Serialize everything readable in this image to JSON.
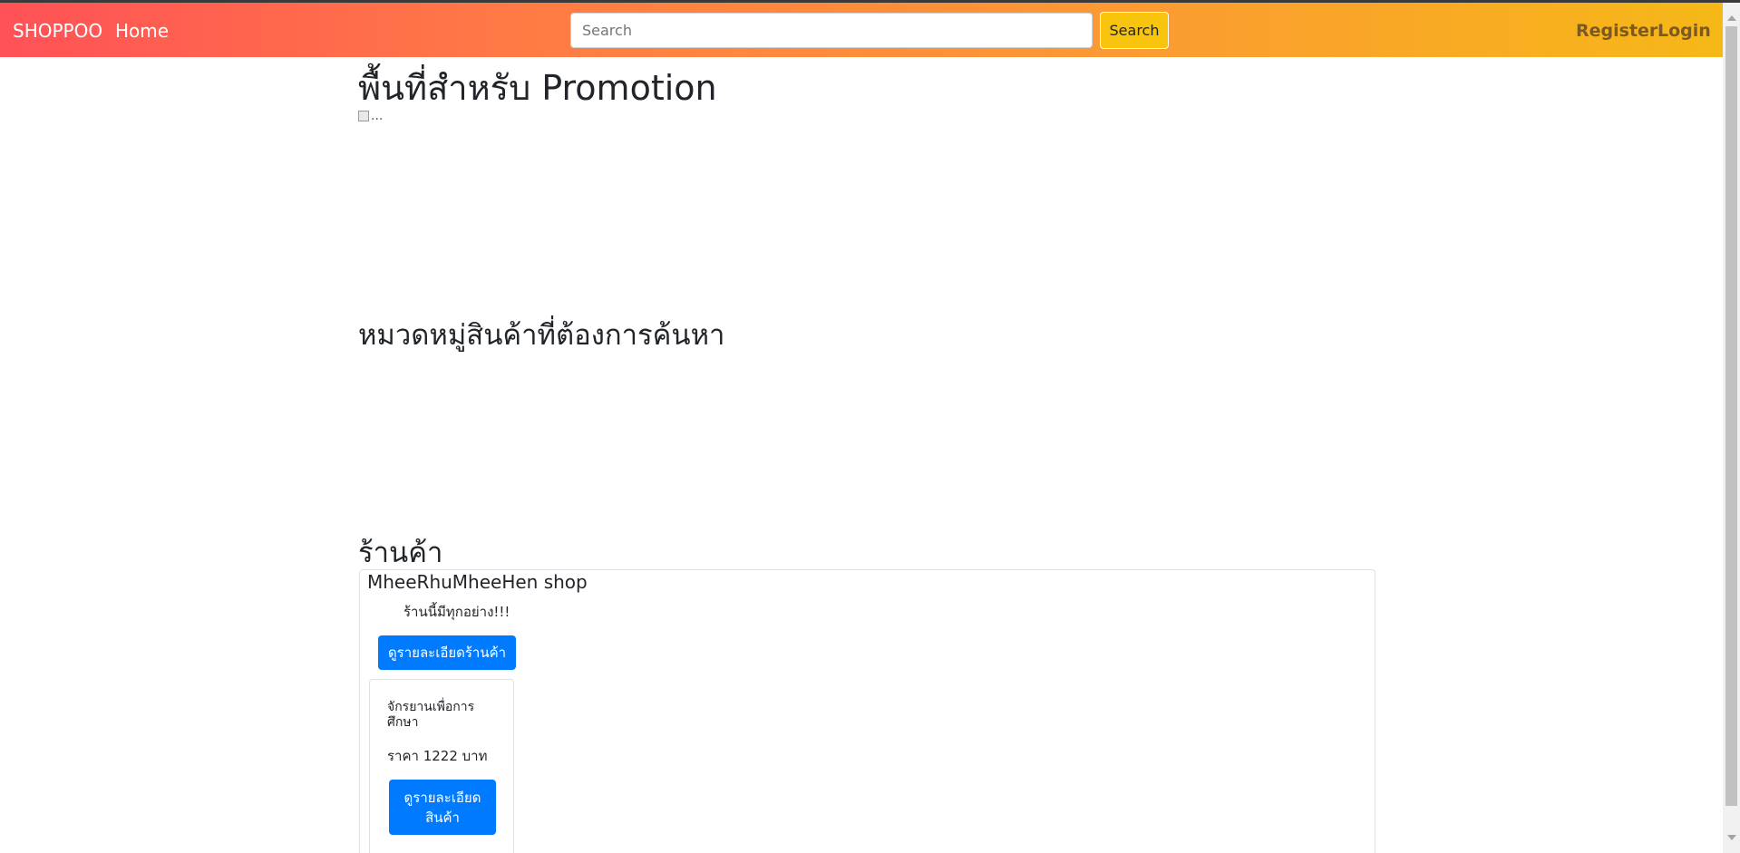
{
  "navbar": {
    "brand": "SHOPPOO",
    "home": "Home",
    "search_placeholder": "Search",
    "search_button": "Search",
    "register": "Register",
    "login": "Login",
    "colors": {
      "gradient_start": "#ff5157",
      "gradient_end": "#f6b817",
      "search_button": "#f8c40d"
    }
  },
  "promo": {
    "title": "พื้นที่สำหรับ Promotion",
    "image_alt": "..."
  },
  "categories": {
    "title": "หมวดหมู่สินค้าที่ต้องการค้นหา"
  },
  "shops": {
    "title": "ร้านค้า",
    "items": [
      {
        "name": "MheeRhuMheeHen shop",
        "description": "ร้านนี้มีทุกอย่าง!!!",
        "detail_button": "ดูรายละเอียดร้านค้า",
        "products": [
          {
            "name": "จักรยานเพื่อการศึกษา",
            "price": "ราคา 1222 บาท",
            "detail_button": "ดูรายละเอียดสินค้า"
          }
        ]
      }
    ]
  },
  "accent_color": "#007bff"
}
